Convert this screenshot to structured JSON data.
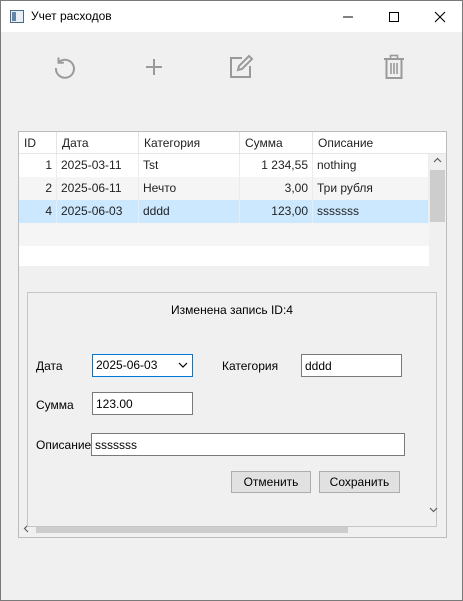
{
  "window": {
    "title": "Учет расходов",
    "accent": "#0078d7"
  },
  "toolbar": {
    "icons": [
      "refresh-icon",
      "add-icon",
      "edit-icon",
      "delete-icon"
    ],
    "icon_color": "#9a9a9a"
  },
  "table": {
    "columns": [
      "ID",
      "Дата",
      "Категория",
      "Сумма",
      "Описание"
    ],
    "rows": [
      {
        "id": "1",
        "date": "2025-03-11",
        "category": "Tst",
        "amount": "1 234,55",
        "description": "nothing"
      },
      {
        "id": "2",
        "date": "2025-06-11",
        "category": "Нечто",
        "amount": "3,00",
        "description": "Три рубля"
      },
      {
        "id": "4",
        "date": "2025-06-03",
        "category": "dddd",
        "amount": "123,00",
        "description": "sssssss"
      }
    ],
    "selected_row": "4",
    "selection_color": "#cce8ff"
  },
  "edit": {
    "status": "Изменена запись ID:4",
    "date_label": "Дата",
    "date_value": "2025-06-03",
    "category_label": "Категория",
    "category_value": "dddd",
    "amount_label": "Сумма",
    "amount_value": "123.00",
    "description_label": "Описание",
    "description_value": "sssssss",
    "cancel_label": "Отменить",
    "save_label": "Сохранить"
  }
}
